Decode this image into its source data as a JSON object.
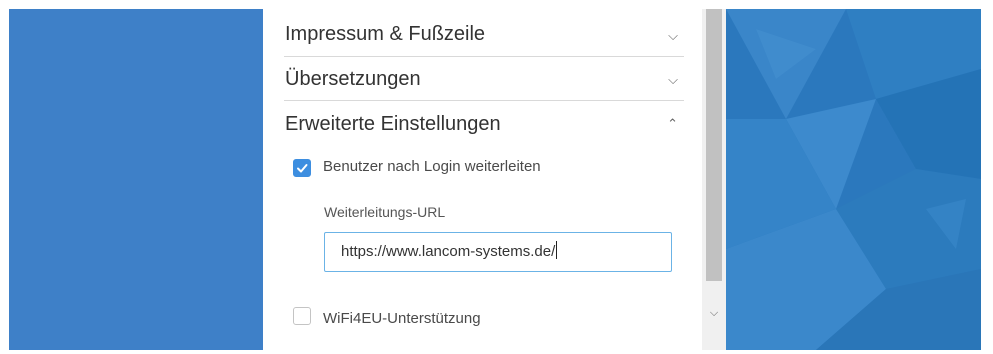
{
  "sections": [
    {
      "title": "Impressum & Fußzeile",
      "chevron": "chevron-down-icon"
    },
    {
      "title": "Übersetzungen",
      "chevron": "chevron-down-icon"
    },
    {
      "title": "Erweiterte Einstellungen",
      "chevron": "chevron-up-icon"
    }
  ],
  "advanced": {
    "redirect_checkbox_label": "Benutzer nach Login weiterleiten",
    "redirect_checked": true,
    "redirect_url_label": "Weiterleitungs-URL",
    "redirect_url_value": "https://www.lancom-systems.de/",
    "wifi4eu_label": "WiFi4EU-Unterstützung",
    "wifi4eu_checked": false
  },
  "colors": {
    "accent": "#3d8ee0",
    "background_blue": "#3e80c8"
  }
}
